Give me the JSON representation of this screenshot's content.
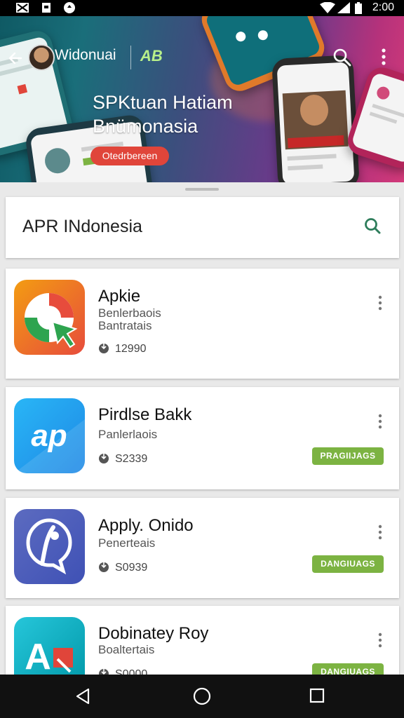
{
  "status_bar": {
    "time": "2:00"
  },
  "hero": {
    "brand": "Widonuai",
    "logo": "AB",
    "title_line1": "SPKtuan Hatiam",
    "title_line2": "Bnümonasia",
    "badge": "Otedrbereen"
  },
  "search": {
    "query": "APR INdonesia"
  },
  "apps": [
    {
      "name": "Apkie",
      "sub1": "Benlerbaois",
      "sub2": "Bantratais",
      "count": "12990",
      "tag": ""
    },
    {
      "name": "Pirdlse Bakk",
      "sub1": "Panlerlaois",
      "sub2": "",
      "count": "S2339",
      "tag": "PRAGIIJAGS"
    },
    {
      "name": "Apply. Onido",
      "sub1": "Penerteais",
      "sub2": "",
      "count": "S0939",
      "tag": "DANGIUAGS"
    },
    {
      "name": "Dobinatey Roy",
      "sub1": "Boaltertais",
      "sub2": "",
      "count": "S0000",
      "tag": "DANGIUAGS"
    }
  ],
  "colors": {
    "accent_green": "#7cb342",
    "search_icon": "#2e7d5b",
    "badge_red": "#e0453a"
  }
}
